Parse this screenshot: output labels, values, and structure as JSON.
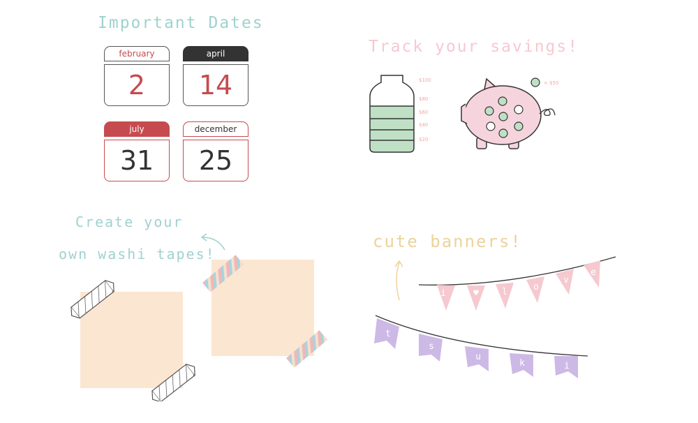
{
  "colors": {
    "teal": "#9fd2cf",
    "pink_light": "#f6c9d2",
    "gold": "#ecd39b",
    "red": "#c64b4f",
    "dark": "#333333",
    "green": "#bfe0c5",
    "peach": "#fbe6d2",
    "banner_pink": "#f5c9cf",
    "banner_purple": "#cdb9e6"
  },
  "important_dates": {
    "heading": "Important Dates",
    "calendars": [
      {
        "month": "february",
        "day": "2"
      },
      {
        "month": "april",
        "day": "14"
      },
      {
        "month": "july",
        "day": "31"
      },
      {
        "month": "december",
        "day": "25"
      }
    ]
  },
  "savings": {
    "heading": "Track your savings!",
    "jar_amounts": [
      "$100",
      "$80",
      "$60",
      "$40",
      "$20"
    ],
    "coin_label": "= $50"
  },
  "washi": {
    "heading_line1": "Create your",
    "heading_line2": "own washi tapes!"
  },
  "banners": {
    "heading": "cute banners!",
    "top_letters": [
      "i",
      "♥",
      "l",
      "o",
      "v",
      "e"
    ],
    "bottom_letters": [
      "t",
      "s",
      "u",
      "k",
      "i"
    ]
  }
}
